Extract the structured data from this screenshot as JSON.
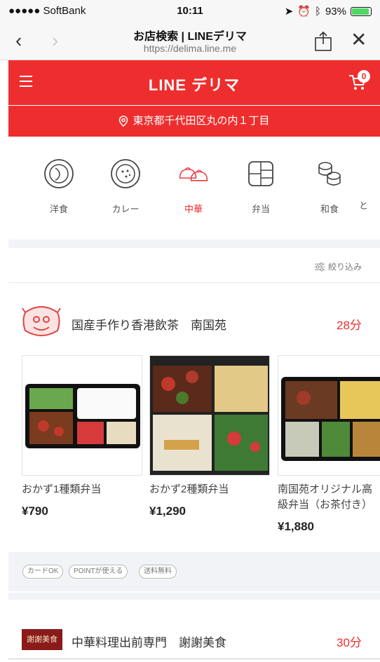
{
  "status_bar": {
    "carrier": "●●●●● SoftBank",
    "time": "10:11",
    "battery_text": "93%",
    "battery_level": 0.93
  },
  "browser": {
    "title": "お店検索 | LINEデリマ",
    "url": "https://delima.line.me"
  },
  "header": {
    "logo": "LINE デリマ",
    "cart_count": "0",
    "location": "東京都千代田区丸の内１丁目",
    "accent_color": "#ee2e2e"
  },
  "categories": [
    {
      "label": "洋食",
      "icon": "western-food-icon"
    },
    {
      "label": "カレー",
      "icon": "curry-icon"
    },
    {
      "label": "中華",
      "icon": "chinese-dumpling-icon",
      "active": true
    },
    {
      "label": "弁当",
      "icon": "bento-icon"
    },
    {
      "label": "和食",
      "icon": "sushi-icon"
    },
    {
      "label": "と",
      "icon": "next-category-icon"
    }
  ],
  "filter_label": "絞り込み",
  "shops": [
    {
      "name": "国産手作り香港飲茶　南国苑",
      "delivery_time": "28分",
      "items": [
        {
          "name": "おかず1種類弁当",
          "price": "¥790"
        },
        {
          "name": "おかず2種類弁当",
          "price": "¥1,290"
        },
        {
          "name": "南国苑オリジナル高級弁当（お茶付き）",
          "price": "¥1,880"
        }
      ],
      "tags": [
        "カードOK",
        "POINTが使える",
        "送料無料"
      ]
    },
    {
      "name": "中華料理出前専門　謝謝美食",
      "delivery_time": "30分",
      "logo_text": "謝謝美食"
    }
  ]
}
